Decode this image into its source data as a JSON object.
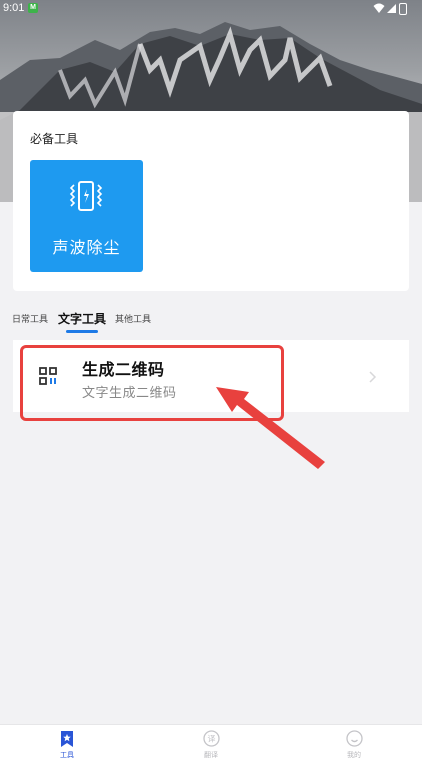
{
  "status_bar": {
    "time": "9:01",
    "app_badge": "M"
  },
  "essential": {
    "title": "必备工具",
    "tool": {
      "label": "声波除尘",
      "icon": "phone-vibrate-icon"
    }
  },
  "tabs": [
    {
      "label": "日常工具",
      "active": false
    },
    {
      "label": "文字工具",
      "active": true
    },
    {
      "label": "其他工具",
      "active": false
    }
  ],
  "list": [
    {
      "title": "生成二维码",
      "subtitle": "文字生成二维码",
      "icon": "qr-code-icon"
    }
  ],
  "bottom_nav": [
    {
      "label": "工具",
      "icon": "bookmark-star-icon",
      "active": true
    },
    {
      "label": "翻译",
      "icon": "translate-icon",
      "active": false
    },
    {
      "label": "我的",
      "icon": "smiley-icon",
      "active": false
    }
  ],
  "colors": {
    "accent": "#1e9af0",
    "tab_indicator": "#1e7ae6",
    "nav_active": "#2a55d6",
    "annotation": "#e8413e"
  }
}
